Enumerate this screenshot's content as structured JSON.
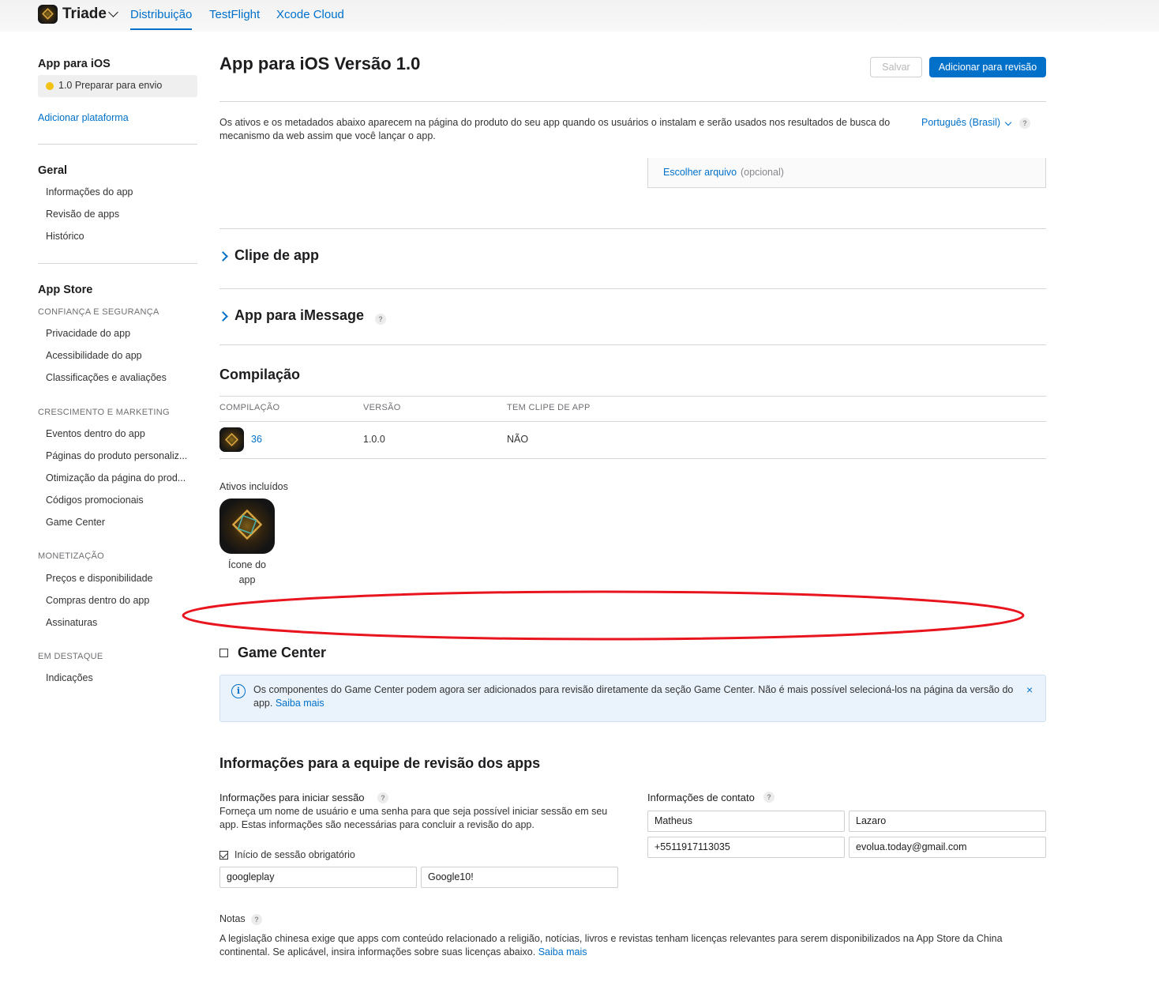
{
  "topbar": {
    "app_name": "Triade",
    "tabs": [
      {
        "label": "Distribuição",
        "active": true
      },
      {
        "label": "TestFlight",
        "active": false
      },
      {
        "label": "Xcode Cloud",
        "active": false
      }
    ]
  },
  "sidebar": {
    "platform_title": "App para iOS",
    "version_status": "1.0 Preparar para envio",
    "add_platform": "Adicionar plataforma",
    "general_title": "Geral",
    "general_items": [
      "Informações do app",
      "Revisão de apps",
      "Histórico"
    ],
    "appstore_title": "App Store",
    "sections": [
      {
        "title": "CONFIANÇA E SEGURANÇA",
        "items": [
          "Privacidade do app",
          "Acessibilidade do app",
          "Classificações e avaliações"
        ]
      },
      {
        "title": "CRESCIMENTO E MARKETING",
        "items": [
          "Eventos dentro do app",
          "Páginas do produto personaliz...",
          "Otimização da página do prod...",
          "Códigos promocionais",
          "Game Center"
        ]
      },
      {
        "title": "MONETIZAÇÃO",
        "items": [
          "Preços e disponibilidade",
          "Compras dentro do app",
          "Assinaturas"
        ]
      },
      {
        "title": "EM DESTAQUE",
        "items": [
          "Indicações"
        ]
      }
    ]
  },
  "main": {
    "title": "App para iOS Versão 1.0",
    "save_label": "Salvar",
    "submit_label": "Adicionar para revisão",
    "description": "Os ativos e os metadados abaixo aparecem na página do produto do seu app quando os usuários o instalam e serão usados nos resultados de busca do mecanismo da web assim que você lançar o app.",
    "language": "Português (Brasil)",
    "help_mark": "?",
    "choose_file": "Escolher arquivo",
    "optional": "(opcional)",
    "app_clip_title": "Clipe de app",
    "imessage_title": "App para iMessage",
    "build": {
      "title": "Compilação",
      "headers": [
        "COMPILAÇÃO",
        "VERSÃO",
        "TEM CLIPE DE APP"
      ],
      "row": {
        "build": "36",
        "version": "1.0.0",
        "has_clip": "NÃO"
      }
    },
    "assets_label": "Ativos incluídos",
    "asset_caption": "Ícone do app",
    "annotation_color": "#e8141e",
    "game_center": {
      "title": "Game Center",
      "notice": "Os componentes do Game Center podem agora ser adicionados para revisão diretamente da seção Game Center. Não é mais possível selecioná-los na página da versão do app.",
      "notice_link": "Saiba mais",
      "info_glyph": "i",
      "close_glyph": "×"
    },
    "review_info": {
      "title": "Informações para a equipe de revisão dos apps",
      "signin_label": "Informações para iniciar sessão",
      "signin_desc": "Forneça um nome de usuário e uma senha para que seja possível iniciar sessão em seu app. Estas informações são necessárias para concluir a revisão do app.",
      "signin_required_label": "Início de sessão obrigatório",
      "username": "googleplay",
      "password": "Google10!",
      "contact_label": "Informações de contato",
      "first_name": "Matheus",
      "last_name": "Lazaro",
      "phone": "+5511917113035",
      "email": "evolua.today@gmail.com",
      "notes_label": "Notas",
      "notes_text": "A legislação chinesa exige que apps com conteúdo relacionado a religião, notícias, livros e revistas tenham licenças relevantes para serem disponibilizados na App Store da China continental. Se aplicável, insira informações sobre suas licenças abaixo.",
      "notes_link": "Saiba mais"
    }
  }
}
